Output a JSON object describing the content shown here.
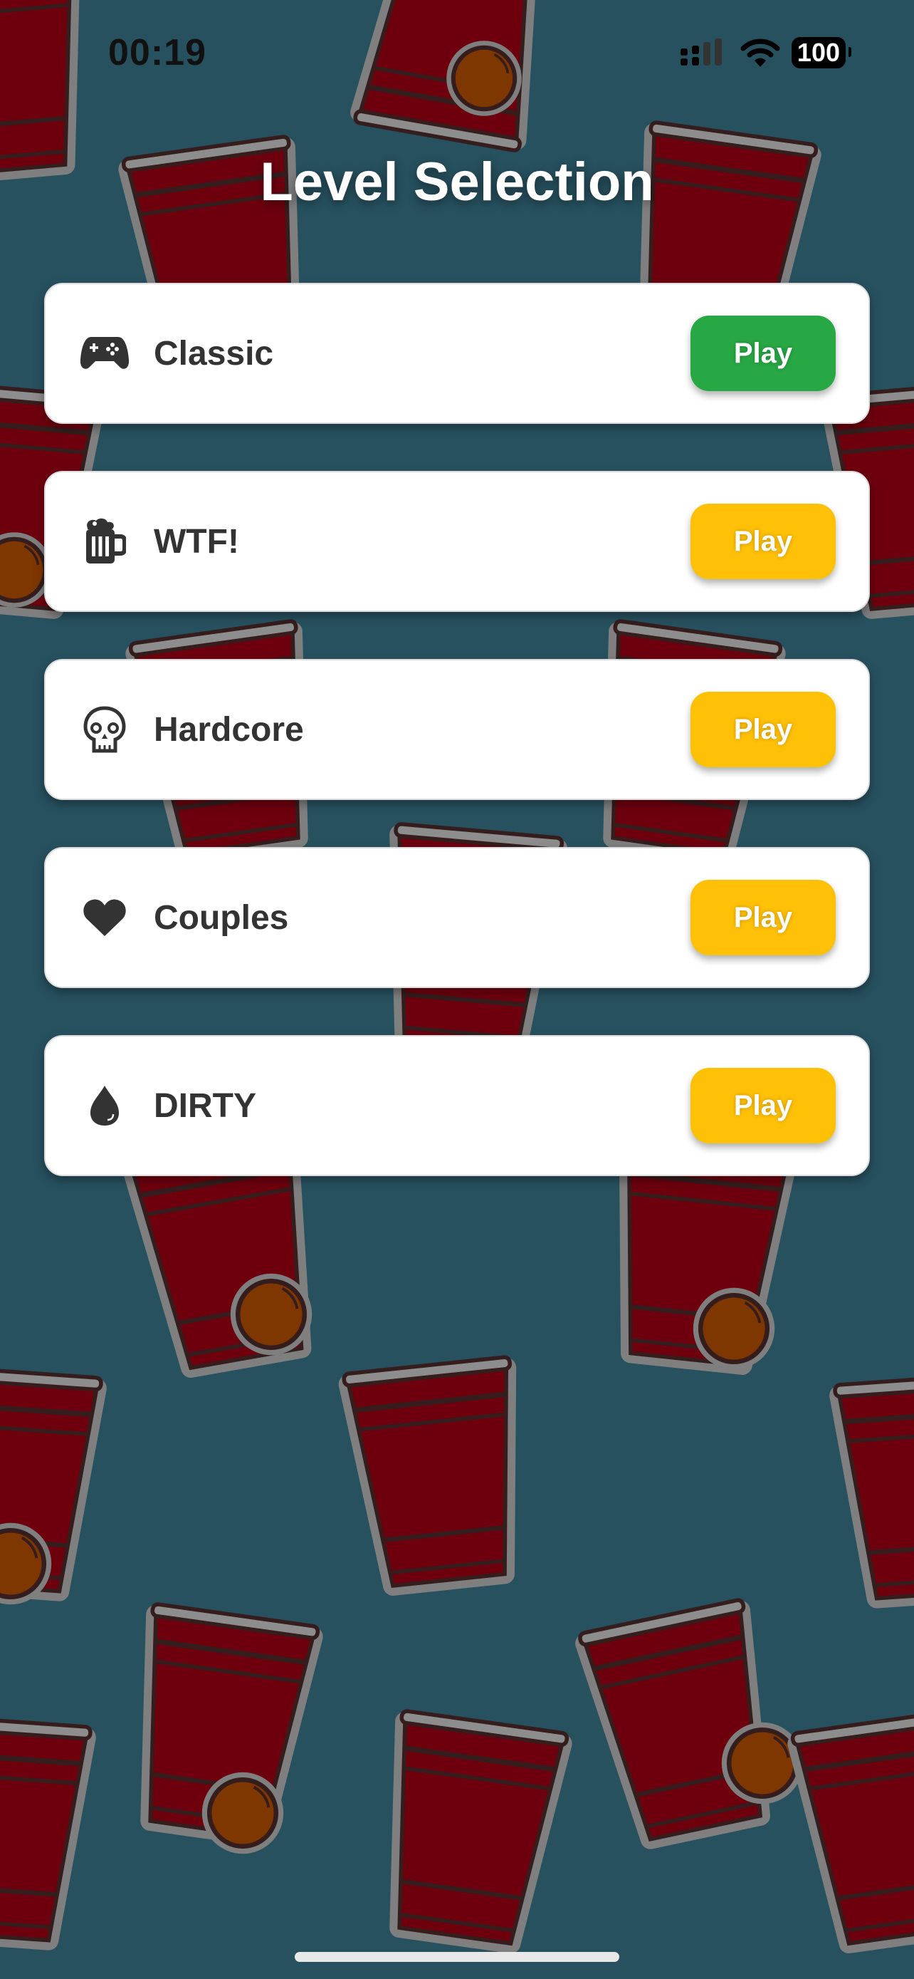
{
  "status_bar": {
    "time": "00:19",
    "battery": "100"
  },
  "header": {
    "title": "Level Selection"
  },
  "levels": [
    {
      "label": "Classic",
      "icon": "gamepad-icon",
      "button": "Play",
      "button_color": "#28a745"
    },
    {
      "label": "WTF!",
      "icon": "beer-mug-icon",
      "button": "Play",
      "button_color": "#ffc107"
    },
    {
      "label": "Hardcore",
      "icon": "skull-icon",
      "button": "Play",
      "button_color": "#ffc107"
    },
    {
      "label": "Couples",
      "icon": "heart-icon",
      "button": "Play",
      "button_color": "#ffc107"
    },
    {
      "label": "DIRTY",
      "icon": "water-drop-icon",
      "button": "Play",
      "button_color": "#ffc107"
    }
  ],
  "colors": {
    "background": "#2b5868",
    "cup": "#7a0010",
    "ball": "#8a3c00"
  }
}
